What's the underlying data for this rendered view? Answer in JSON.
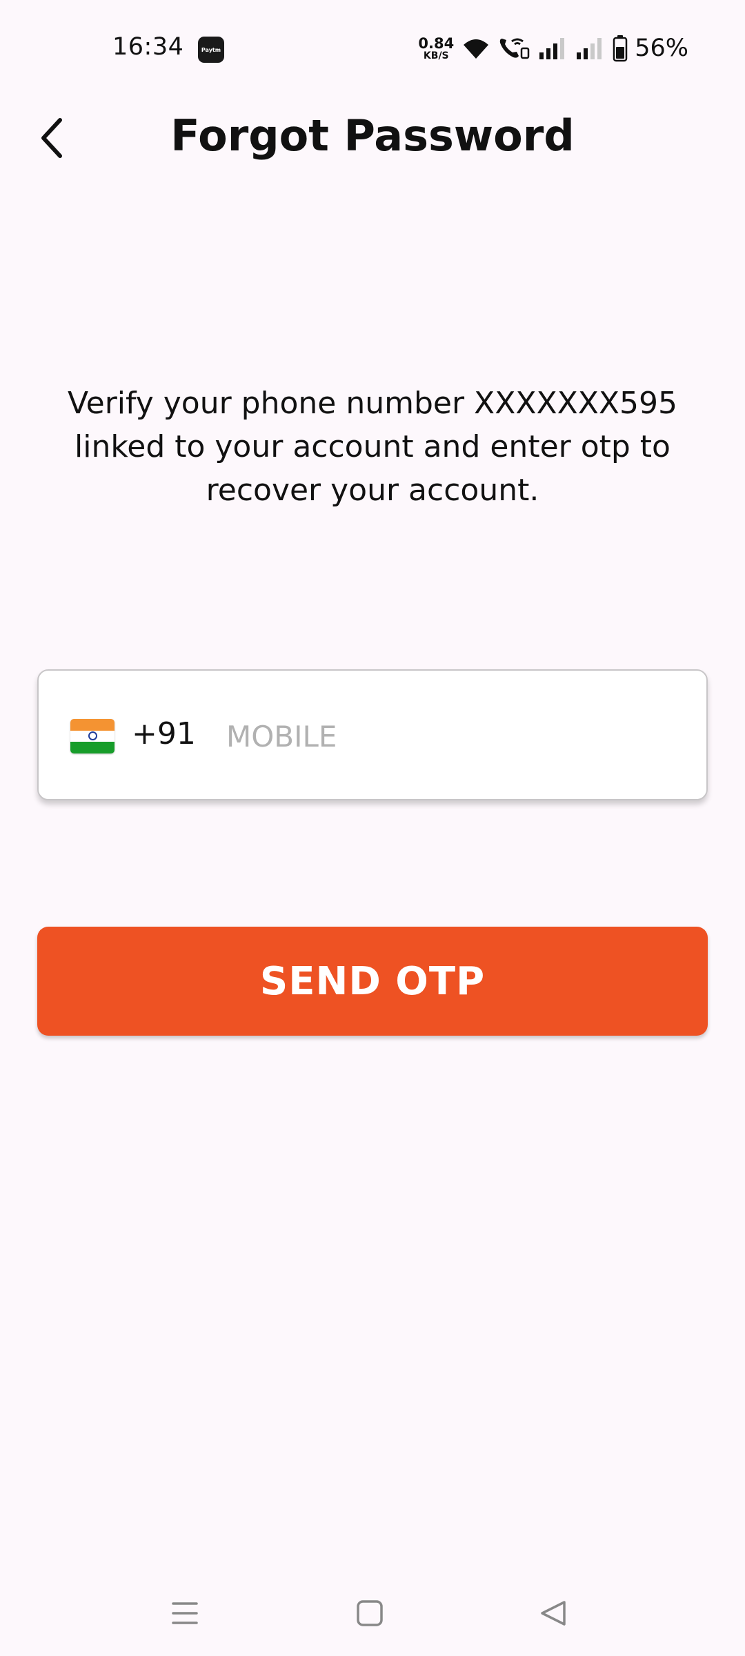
{
  "status_bar": {
    "time": "16:34",
    "app_badge": "Paytm",
    "net_speed_value": "0.84",
    "net_speed_unit": "KB/S",
    "battery": "56%",
    "icons": [
      "paytm-icon",
      "wifi-icon",
      "wifi-calling-icon",
      "signal-icon",
      "signal-icon",
      "battery-icon"
    ]
  },
  "header": {
    "title": "Forgot Password",
    "back_icon": "chevron-left-icon"
  },
  "instruction": "Verify your phone number XXXXXXX595 linked to your account and enter otp to recover your account.",
  "phone_field": {
    "flag": "india-flag-icon",
    "country_code": "+91",
    "value": "",
    "placeholder": "MOBILE"
  },
  "send_button": {
    "label": "SEND OTP"
  },
  "colors": {
    "background": "#fdf8fc",
    "accent": "#ee5223",
    "placeholder": "#b1b1b1"
  },
  "nav_bar": {
    "icons": [
      "menu-icon",
      "home-square-icon",
      "back-triangle-icon"
    ]
  }
}
